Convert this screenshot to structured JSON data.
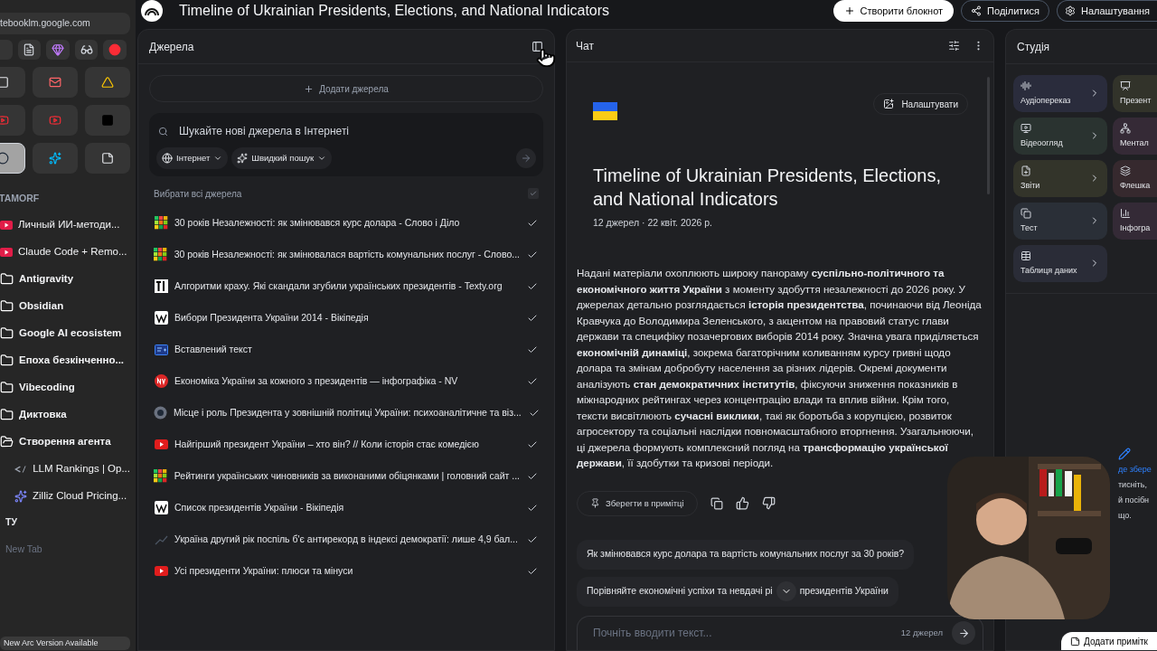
{
  "browser": {
    "url": "tebooklm.google.com",
    "pinned": [
      {
        "kind": "blank",
        "selected": false
      },
      {
        "kind": "fx",
        "selected": false
      },
      {
        "kind": "gem",
        "selected": false
      },
      {
        "kind": "glasses",
        "selected": false
      },
      {
        "kind": "red",
        "selected": false
      },
      {
        "kind": "grid",
        "selected": false
      },
      {
        "kind": "mail",
        "selected": false
      },
      {
        "kind": "drive",
        "selected": false
      },
      {
        "kind": "youtube",
        "selected": false
      },
      {
        "kind": "youtube",
        "selected": false
      },
      {
        "kind": "square",
        "selected": false
      },
      {
        "kind": "ring",
        "selected": true
      },
      {
        "kind": "spark",
        "selected": false
      },
      {
        "kind": "note",
        "selected": false
      }
    ],
    "section": "TAMORF",
    "items": [
      {
        "kind": "video-tab",
        "label": "Личный ИИ-методи..."
      },
      {
        "kind": "video-tab",
        "label": "Claude Code + Remo..."
      },
      {
        "kind": "folder",
        "label": "Antigravity",
        "expanded": false
      },
      {
        "kind": "folder",
        "label": "Obsidian",
        "expanded": false
      },
      {
        "kind": "folder",
        "label": "Google AI ecosistem",
        "expanded": false
      },
      {
        "kind": "folder",
        "label": "Епоха безкінченно...",
        "expanded": false
      },
      {
        "kind": "folder",
        "label": "Vibecoding",
        "expanded": false
      },
      {
        "kind": "folder",
        "label": "Диктовка",
        "expanded": false
      },
      {
        "kind": "folder",
        "label": "Створення агента",
        "expanded": true,
        "children": [
          {
            "kind": "router-tab",
            "label": "LLM Rankings | Op..."
          },
          {
            "kind": "star-tab",
            "label": "Zilliz Cloud Pricing..."
          }
        ]
      }
    ],
    "section_2": "ТУ",
    "new_tab": "New Tab",
    "update_notice": "New Arc Version Available"
  },
  "header": {
    "title": "Timeline of Ukrainian Presidents, Elections, and National Indicators",
    "create_button": "Створити блокнот",
    "share_button": "Поділитися",
    "settings_button": "Налаштування"
  },
  "sources": {
    "title": "Джерела",
    "add_button": "Додати джерела",
    "search": {
      "placeholder": "Шукайте нові джерела в Інтернеті",
      "scope": "Інтернет",
      "mode": "Швидкий пошук"
    },
    "select_all": {
      "label": "Вибрати всі джерела",
      "checked": true
    },
    "items": [
      {
        "kind": "grid",
        "title": "30 років Незалежності: як змінювався курс долара - Слово і Діло",
        "checked": true
      },
      {
        "kind": "grid",
        "title": "30 років Незалежності: як змінювалася вартість комунальних послуг - Слово...",
        "checked": true
      },
      {
        "kind": "texty",
        "title": "Алгоритми краху. Які скандали згубили українських президентів - Texty.org",
        "checked": true
      },
      {
        "kind": "wiki",
        "title": "Вибори Президента України 2014 - Вікіпедія",
        "checked": true
      },
      {
        "kind": "pasted",
        "title": "Вставлений текст",
        "checked": true
      },
      {
        "kind": "nv",
        "title": "Економіка України за кожного з президентів — інфографіка - NV",
        "checked": true
      },
      {
        "kind": "globe",
        "title": "Місце і роль Президента у зовнішній політиці України: психоаналітичне та віз...",
        "checked": true
      },
      {
        "kind": "youtube",
        "title": "Найгірший президент України – хто він? // Коли історія стає комедією",
        "checked": true
      },
      {
        "kind": "grid",
        "title": "Рейтинги українських чиновників за виконаними обіцянками | головний сайт ...",
        "checked": true
      },
      {
        "kind": "wiki",
        "title": "Список президентів України - Вікіпедія",
        "checked": true
      },
      {
        "kind": "trend",
        "title": "Україна другий рік поспіль б'є антирекорд в індексі демократії: лише 4,9 бал...",
        "checked": true
      },
      {
        "kind": "youtube",
        "title": "Усі президенти України: плюси та мінуси",
        "checked": true
      }
    ]
  },
  "chat": {
    "title": "Чат",
    "customize_button": "Налаштувати",
    "notebook_title": "Timeline of Ukrainian Presidents, Elections, and National Indicators",
    "meta": "12 джерел · 22 квіт. 2026 р.",
    "summary": "Надані матеріали охоплюють широку панораму **суспільно-політичного та економічного життя України** з моменту здобуття незалежності до 2026 року. У джерелах детально розглядається **історія президентства**, починаючи від Леоніда Кравчука до Володимира Зеленського, з акцентом на правовий статус глави держави та специфіку позачергових виборів 2014 року. Значна увага приділяється **економічній динаміці**, зокрема багаторічним коливанням курсу гривні щодо долара та змінам добробуту населення за різних лідерів. Окремі документи аналізують **стан демократичних інститутів**, фіксуючи зниження показників в міжнародних рейтингах через концентрацію влади та вплив війни. Крім того, тексти висвітлюють **сучасні виклики**, такі як боротьба з корупцією, розвиток агросектору та соціальні наслідки повномасштабного вторгнення. Узагальнюючи, ці джерела формують комплексний погляд на **трансформацію української держави**, її здобутки та кризові періоди.",
    "save_note_button": "Зберегти в примітці",
    "suggestions": [
      {
        "text": "Як змінювався курс долара та вартість комунальних послуг за 30 років?"
      },
      {
        "text": "Порівняйте економічні успіхи та невдачі рі",
        "text_after": "президентів України"
      }
    ],
    "input": {
      "placeholder": "Почніть вводити текст...",
      "source_count": "12 джерел"
    }
  },
  "studio": {
    "title": "Студія",
    "cards": [
      {
        "kind": "audio",
        "label": "Аудіопереказ",
        "color": "#2a2c3c"
      },
      {
        "kind": "slides",
        "label": "Презент",
        "color": "#32332a"
      },
      {
        "kind": "video",
        "label": "Відеоогляд",
        "color": "#2a3330"
      },
      {
        "kind": "mindmap",
        "label": "Ментал",
        "color": "#352a36"
      },
      {
        "kind": "reports",
        "label": "Звіти",
        "color": "#33342a"
      },
      {
        "kind": "flashcards",
        "label": "Флешка",
        "color": "#36292e"
      },
      {
        "kind": "test",
        "label": "Тест",
        "color": "#2a2f37"
      },
      {
        "kind": "infographic",
        "label": "Інфогра",
        "color": "#342a36"
      },
      {
        "kind": "table",
        "label": "Таблиця даних",
        "color": "#2a2c37"
      }
    ],
    "note_lines": [
      {
        "text": "де збере",
        "link": true
      },
      {
        "text": "тисніть,",
        "link": false
      },
      {
        "text": "й посібн",
        "link": false
      },
      {
        "text": "що.",
        "link": false
      }
    ],
    "add_note_button": "Додати примітк"
  }
}
